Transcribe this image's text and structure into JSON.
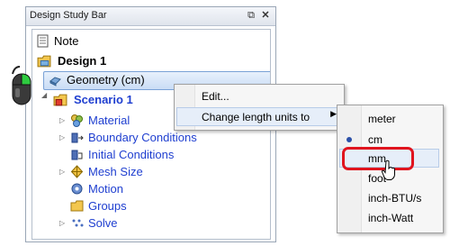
{
  "panel": {
    "title": "Design Study Bar",
    "restore_icon": "restore-icon",
    "close_icon": "close-icon"
  },
  "tree": {
    "note": "Note",
    "design": "Design 1",
    "geometry": "Geometry (cm)",
    "scenario": "Scenario 1",
    "children": [
      {
        "label": "Material",
        "icon": "material-icon"
      },
      {
        "label": "Boundary Conditions",
        "icon": "boundary-conditions-icon"
      },
      {
        "label": "Initial Conditions",
        "icon": "initial-conditions-icon"
      },
      {
        "label": "Mesh Size",
        "icon": "mesh-size-icon"
      },
      {
        "label": "Motion",
        "icon": "motion-icon"
      },
      {
        "label": "Groups",
        "icon": "groups-icon"
      },
      {
        "label": "Solve",
        "icon": "solve-icon"
      }
    ]
  },
  "context_menu": {
    "edit": "Edit...",
    "change_units": "Change length units to"
  },
  "units_menu": {
    "items": [
      "meter",
      "cm",
      "mm",
      "foot",
      "inch-BTU/s",
      "inch-Watt"
    ],
    "selected": "cm",
    "hovered": "mm"
  },
  "colors": {
    "tree_link": "#1f3fd0",
    "callout": "#e0141e",
    "mouse_button": "#2ecc40"
  }
}
